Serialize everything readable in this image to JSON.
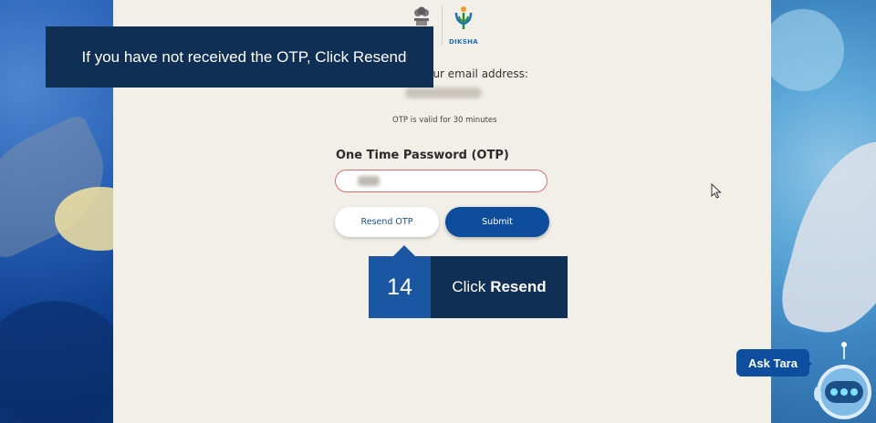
{
  "tutorial": {
    "banner_text": "If you have not received the OTP, Click Resend",
    "step_number": "14",
    "step_prefix": "Click",
    "step_action": "Resend"
  },
  "brand": {
    "logo_text": "DIKSHA"
  },
  "form": {
    "email_prompt": "your email address:",
    "validity_note": "OTP is valid for 30 minutes",
    "otp_label": "One Time Password (OTP)",
    "resend_label": "Resend OTP",
    "submit_label": "Submit"
  },
  "assistant": {
    "label": "Ask Tara"
  },
  "colors": {
    "primary": "#0d4d9b",
    "tooltip_dark": "#0f2f54",
    "step_blue": "#1a56a2",
    "input_error_border": "#e06b6b"
  }
}
